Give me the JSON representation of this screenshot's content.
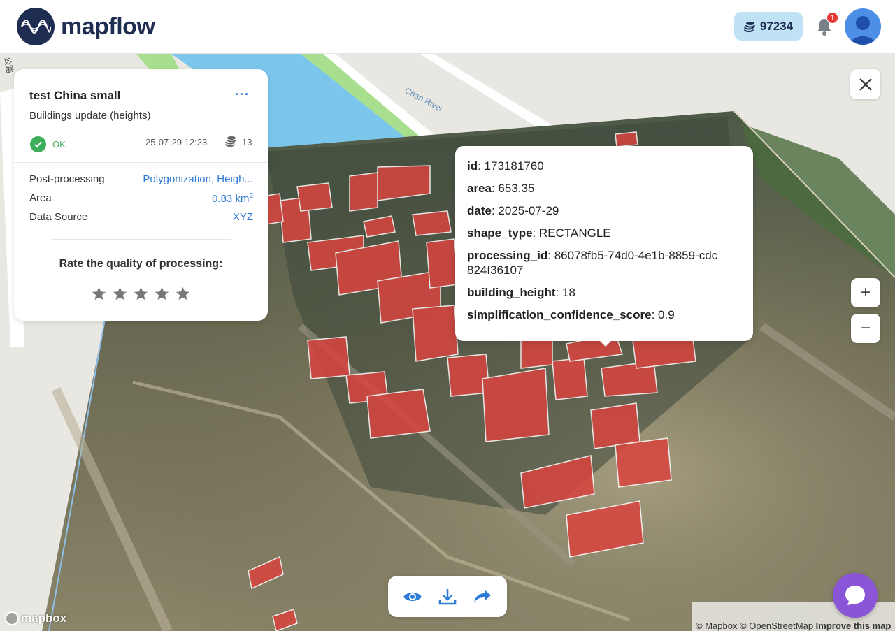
{
  "header": {
    "logo_text": "mapflow",
    "credits": "97234",
    "notifications_count": "1"
  },
  "map_labels": {
    "river": "Chan River",
    "road": "公路"
  },
  "info_card": {
    "title": "test China small",
    "more_label": "···",
    "subtitle": "Buildings update (heights)",
    "status": "OK",
    "date": "25-07-29 12:23",
    "cost": "13",
    "properties": [
      {
        "label": "Post-processing",
        "value": "Polygonization, Heigh..."
      },
      {
        "label": "Area",
        "value": "0.83 km",
        "sup": "2"
      },
      {
        "label": "Data Source",
        "value": "XYZ"
      }
    ],
    "rate_label": "Rate the quality of processing:",
    "rating_max": 5,
    "rating_value": 0
  },
  "popup": {
    "rows": [
      {
        "key": "id",
        "value": ": 173181760"
      },
      {
        "key": "area",
        "value": ": 653.35"
      },
      {
        "key": "date",
        "value": ": 2025-07-29"
      },
      {
        "key": "shape_type",
        "value": ": RECTANGLE"
      },
      {
        "key": "processing_id",
        "value": ": 86078fb5-74d0-4e1b-8859-cdc824f36107"
      },
      {
        "key": "building_height",
        "value": ": 18"
      },
      {
        "key": "simplification_confidence_score",
        "value": ": 0.9"
      }
    ]
  },
  "controls": {
    "zoom_in": "+",
    "zoom_out": "−"
  },
  "footer": {
    "mapbox_logo": "mapbox",
    "attribution_mapbox": "© Mapbox",
    "attribution_osm": "© OpenStreetMap",
    "attribution_improve": "Improve this map"
  },
  "colors": {
    "brand": "#1f2d52",
    "accent": "#2d7bd6",
    "status_ok": "#3dae5b",
    "building": "#d9443f",
    "chat": "#8a55d6"
  }
}
